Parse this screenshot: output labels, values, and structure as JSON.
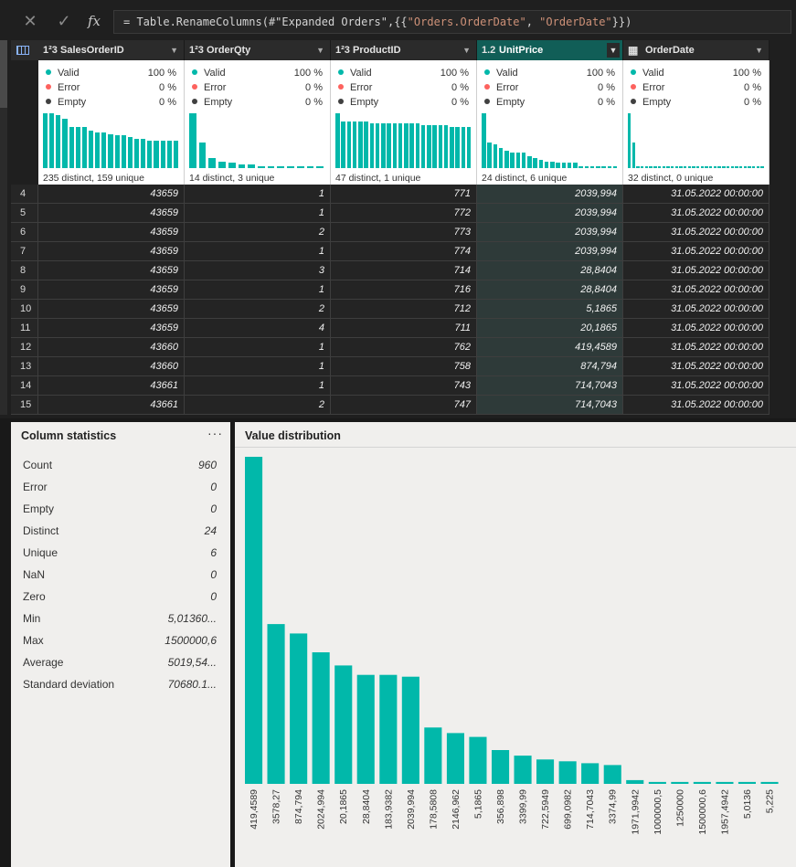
{
  "formula": {
    "prefix": "= Table.RenameColumns(#\"Expanded Orders\",{{",
    "old": "\"Orders.OrderDate\"",
    "comma": ", ",
    "new": "\"OrderDate\"",
    "suffix": "}})"
  },
  "columns": [
    {
      "type": "1²3",
      "name": "SalesOrderID",
      "selected": false,
      "valid": "100 %",
      "error": "0 %",
      "empty": "0 %",
      "foot": "235 distinct, 159 unique",
      "hist": [
        32,
        32,
        31,
        29,
        24,
        24,
        24,
        22,
        21,
        21,
        20,
        19,
        19,
        18,
        17,
        17,
        16,
        16,
        16,
        16,
        16
      ]
    },
    {
      "type": "1²3",
      "name": "OrderQty",
      "selected": false,
      "valid": "100 %",
      "error": "0 %",
      "empty": "0 %",
      "foot": "14 distinct, 3 unique",
      "hist": [
        32,
        15,
        6,
        4,
        3,
        2,
        2,
        1,
        1,
        1,
        1,
        1,
        1,
        1
      ]
    },
    {
      "type": "1²3",
      "name": "ProductID",
      "selected": false,
      "valid": "100 %",
      "error": "0 %",
      "empty": "0 %",
      "foot": "47 distinct, 1 unique",
      "hist": [
        32,
        27,
        27,
        27,
        27,
        27,
        26,
        26,
        26,
        26,
        26,
        26,
        26,
        26,
        26,
        25,
        25,
        25,
        25,
        25,
        24,
        24,
        24,
        24
      ]
    },
    {
      "type": "1.2",
      "name": "UnitPrice",
      "selected": true,
      "valid": "100 %",
      "error": "0 %",
      "empty": "0 %",
      "foot": "24 distinct, 6 unique",
      "hist": [
        32,
        15,
        14,
        12,
        10,
        9,
        9,
        9,
        7,
        6,
        5,
        4,
        4,
        3,
        3,
        3,
        3,
        1,
        1,
        1,
        1,
        1,
        1,
        1
      ]
    },
    {
      "type": "cal",
      "name": "OrderDate",
      "selected": false,
      "valid": "100 %",
      "error": "0 %",
      "empty": "0 %",
      "foot": "32 distinct, 0 unique",
      "hist": [
        32,
        15,
        1,
        1,
        1,
        1,
        1,
        1,
        1,
        1,
        1,
        1,
        1,
        1,
        1,
        1,
        1,
        1,
        1,
        1,
        1,
        1,
        1,
        1,
        1,
        1,
        1,
        1,
        1,
        1,
        1,
        1
      ]
    }
  ],
  "profile_labels": {
    "valid": "Valid",
    "error": "Error",
    "empty": "Empty"
  },
  "profile_colors": {
    "valid": "#01b8aa",
    "error": "#fd625e",
    "empty": "#404040"
  },
  "rows": [
    [
      "4",
      "43659",
      "1",
      "771",
      "2039,994",
      "31.05.2022 00:00:00"
    ],
    [
      "5",
      "43659",
      "1",
      "772",
      "2039,994",
      "31.05.2022 00:00:00"
    ],
    [
      "6",
      "43659",
      "2",
      "773",
      "2039,994",
      "31.05.2022 00:00:00"
    ],
    [
      "7",
      "43659",
      "1",
      "774",
      "2039,994",
      "31.05.2022 00:00:00"
    ],
    [
      "8",
      "43659",
      "3",
      "714",
      "28,8404",
      "31.05.2022 00:00:00"
    ],
    [
      "9",
      "43659",
      "1",
      "716",
      "28,8404",
      "31.05.2022 00:00:00"
    ],
    [
      "10",
      "43659",
      "2",
      "712",
      "5,1865",
      "31.05.2022 00:00:00"
    ],
    [
      "11",
      "43659",
      "4",
      "711",
      "20,1865",
      "31.05.2022 00:00:00"
    ],
    [
      "12",
      "43660",
      "1",
      "762",
      "419,4589",
      "31.05.2022 00:00:00"
    ],
    [
      "13",
      "43660",
      "1",
      "758",
      "874,794",
      "31.05.2022 00:00:00"
    ],
    [
      "14",
      "43661",
      "1",
      "743",
      "714,7043",
      "31.05.2022 00:00:00"
    ],
    [
      "15",
      "43661",
      "2",
      "747",
      "714,7043",
      "31.05.2022 00:00:00"
    ]
  ],
  "stats": {
    "title": "Column statistics",
    "menu": "···",
    "items": [
      {
        "label": "Count",
        "value": "960"
      },
      {
        "label": "Error",
        "value": "0"
      },
      {
        "label": "Empty",
        "value": "0"
      },
      {
        "label": "Distinct",
        "value": "24"
      },
      {
        "label": "Unique",
        "value": "6"
      },
      {
        "label": "NaN",
        "value": "0"
      },
      {
        "label": "Zero",
        "value": "0"
      },
      {
        "label": "Min",
        "value": "5,01360..."
      },
      {
        "label": "Max",
        "value": "1500000,6"
      },
      {
        "label": "Average",
        "value": "5019,54..."
      },
      {
        "label": "Standard deviation",
        "value": "70680.1..."
      }
    ]
  },
  "distribution": {
    "title": "Value distribution"
  },
  "chart_data": {
    "type": "bar",
    "categories": [
      "419,4589",
      "3578,27",
      "874,794",
      "2024,994",
      "20,1865",
      "28,8404",
      "183,9382",
      "2039,994",
      "178,5808",
      "2146,962",
      "5,1865",
      "356,898",
      "3399,99",
      "722,5949",
      "699,0982",
      "714,7043",
      "3374,99",
      "1971,9942",
      "1000000,5",
      "1250000",
      "1500000,6",
      "1957,4942",
      "5,0136",
      "5,225"
    ],
    "values": [
      174,
      85,
      80,
      70,
      63,
      58,
      58,
      57,
      30,
      27,
      25,
      18,
      15,
      13,
      12,
      11,
      10,
      2,
      1,
      1,
      1,
      1,
      1,
      1
    ],
    "color": "#01b8aa"
  }
}
